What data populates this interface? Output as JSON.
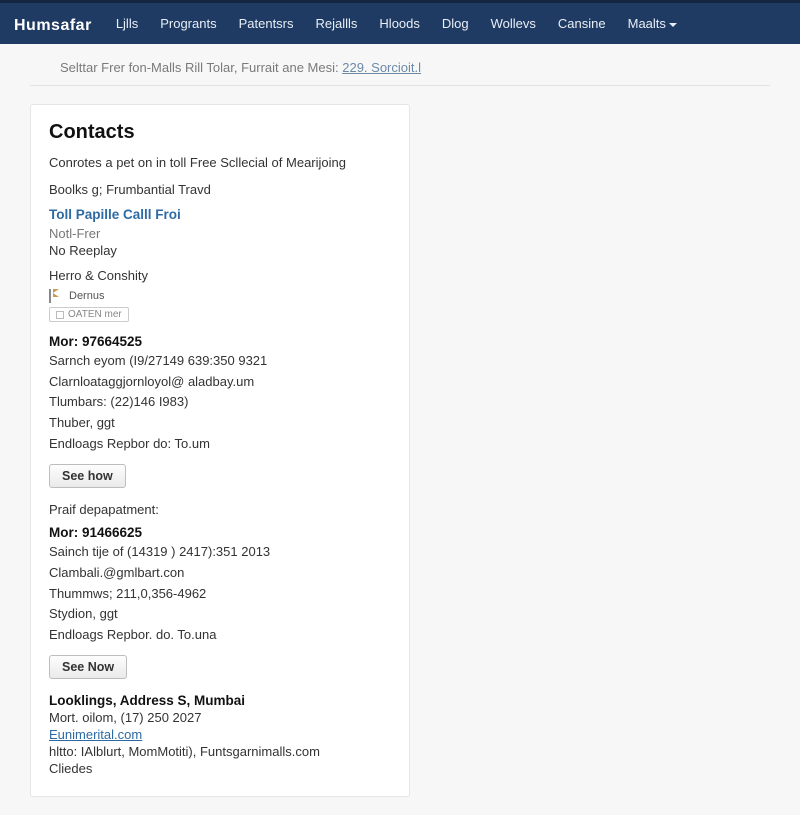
{
  "brand": "Humsafar",
  "nav": {
    "items": [
      {
        "label": "Ljlls"
      },
      {
        "label": "Progrants"
      },
      {
        "label": "Patentsrs"
      },
      {
        "label": "Rejallls"
      },
      {
        "label": "Hloods"
      },
      {
        "label": "Dlog"
      },
      {
        "label": "Wollevs"
      },
      {
        "label": "Cansine"
      },
      {
        "label": "Maalts",
        "dropdown": true
      }
    ]
  },
  "breadcrumb": {
    "prefix": "Selttar Frer fon-Malls Rill Tolar, Furrait ane Mesi: ",
    "link": "229. Sorcioit.l"
  },
  "card": {
    "title": "Contacts",
    "intro": "Conrotes a pet on in toll Free Scllecial of Mearijoing",
    "books": "Boolks g; Frumbantial Travd",
    "toll_label": "Toll Papille Calll Froi",
    "notifier": "Notl-Frer",
    "noreply": "No Reeplay",
    "hero_label": "Herro & Conshity",
    "hero_badge": "Dernus",
    "chip_label": "OATEN mer",
    "block1": {
      "mor": "Mor: 97664525",
      "l1": "Sarnch eyom (I9/27149 639:350 9321",
      "l2": "Clarnloataggjornloyol@ aladbay.um",
      "l3": "Tlumbars: (22)146 I983)",
      "l4": "Thuber, ggt",
      "l5": "Endloags Repbor do: To.um",
      "btn": "See how"
    },
    "dept_label": "Praif depapatment:",
    "block2": {
      "mor": "Mor: 91466625",
      "l1": "Sainch tije of (14319 ) 2417):351 2013",
      "l2": "Clambali.@gmlbart.con",
      "l3": "Thummws; 211,0,356-4962",
      "l4": "Stydion, ggt",
      "l5": "Endloags Repbor. do. To.una",
      "btn": "See Now"
    },
    "address": {
      "title": "Looklings, Address S, Mumbai",
      "l1": "Mort. oilom, (17) 250 2027",
      "link": "Eunimerital.com",
      "l3": "hltto: IAlblurt, MomMotiti), Funtsgarnimalls.com",
      "l4": "Cliedes"
    }
  }
}
